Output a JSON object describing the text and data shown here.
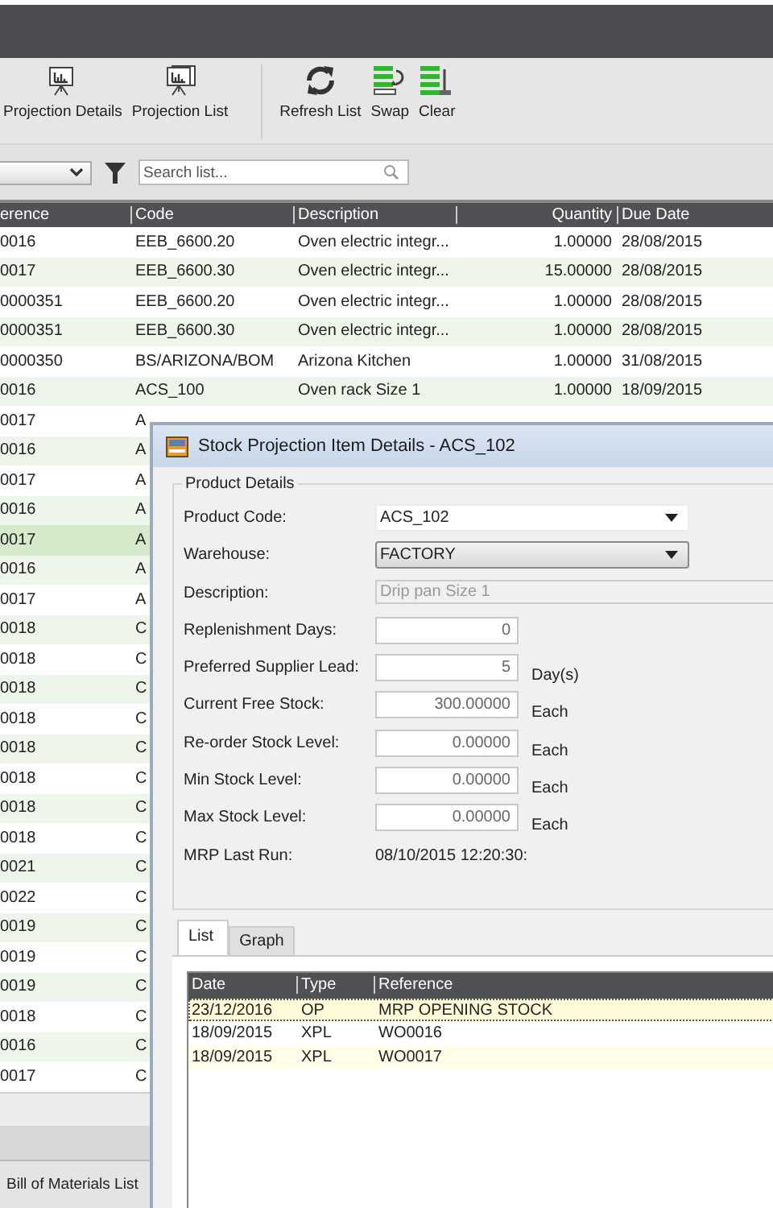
{
  "toolbar": {
    "groups": [
      [
        {
          "label": "Projection Details"
        },
        {
          "label": "Projection List"
        }
      ],
      [
        {
          "label": "Refresh List"
        },
        {
          "label": "Swap"
        },
        {
          "label": "Clear"
        }
      ]
    ]
  },
  "filter": {
    "search": {
      "placeholder": "Search list..."
    }
  },
  "table": {
    "columns": [
      "erence",
      "Code",
      "Description",
      "Quantity",
      "Due Date"
    ],
    "rows": [
      {
        "reference": "0016",
        "code": "EEB_6600.20",
        "description": "Oven electric integr...",
        "quantity": "1.00000",
        "due_date": "28/08/2015",
        "selected": false
      },
      {
        "reference": "0017",
        "code": "EEB_6600.30",
        "description": "Oven electric integr...",
        "quantity": "15.00000",
        "due_date": "28/08/2015",
        "selected": false
      },
      {
        "reference": "0000351",
        "code": "EEB_6600.20",
        "description": "Oven electric integr...",
        "quantity": "1.00000",
        "due_date": "28/08/2015",
        "selected": false
      },
      {
        "reference": "0000351",
        "code": "EEB_6600.30",
        "description": "Oven electric integr...",
        "quantity": "1.00000",
        "due_date": "28/08/2015",
        "selected": false
      },
      {
        "reference": "0000350",
        "code": "BS/ARIZONA/BOM",
        "description": "Arizona Kitchen",
        "quantity": "1.00000",
        "due_date": "31/08/2015",
        "selected": false
      },
      {
        "reference": "0016",
        "code": "ACS_100",
        "description": "Oven rack Size 1",
        "quantity": "1.00000",
        "due_date": "18/09/2015",
        "selected": false
      },
      {
        "reference": "0017",
        "code": "A",
        "selected": false
      },
      {
        "reference": "0016",
        "code": "A",
        "selected": false
      },
      {
        "reference": "0017",
        "code": "A",
        "selected": false
      },
      {
        "reference": "0016",
        "code": "A",
        "selected": false
      },
      {
        "reference": "0017",
        "code": "A",
        "selected": true
      },
      {
        "reference": "0016",
        "code": "A",
        "selected": false
      },
      {
        "reference": "0017",
        "code": "A",
        "selected": false
      },
      {
        "reference": "0018",
        "code": "C",
        "selected": false
      },
      {
        "reference": "0018",
        "code": "C",
        "selected": false
      },
      {
        "reference": "0018",
        "code": "C",
        "selected": false
      },
      {
        "reference": "0018",
        "code": "C",
        "selected": false
      },
      {
        "reference": "0018",
        "code": "C",
        "selected": false
      },
      {
        "reference": "0018",
        "code": "C",
        "selected": false
      },
      {
        "reference": "0018",
        "code": "C",
        "selected": false
      },
      {
        "reference": "0018",
        "code": "C",
        "selected": false
      },
      {
        "reference": "0021",
        "code": "C",
        "selected": false
      },
      {
        "reference": "0022",
        "code": "C",
        "selected": false
      },
      {
        "reference": "0019",
        "code": "C",
        "selected": false
      },
      {
        "reference": "0019",
        "code": "C",
        "selected": false
      },
      {
        "reference": "0019",
        "code": "C",
        "selected": false
      },
      {
        "reference": "0018",
        "code": "C",
        "selected": false
      },
      {
        "reference": "0016",
        "code": "C",
        "selected": false
      },
      {
        "reference": "0017",
        "code": "C",
        "selected": false
      }
    ]
  },
  "bottom_tab": {
    "label": "Bill of Materials List"
  },
  "dialog": {
    "title": "Stock Projection Item Details - ACS_102",
    "group_title": "Product Details",
    "fields": [
      {
        "kind": "dropdown",
        "label": "Product Code:",
        "value": "ACS_102"
      },
      {
        "kind": "select",
        "label": "Warehouse:",
        "value": "FACTORY"
      },
      {
        "kind": "disabled",
        "label": "Description:",
        "value": "Drip pan Size 1"
      },
      {
        "kind": "number",
        "label": "Replenishment Days:",
        "value": "0"
      },
      {
        "kind": "number",
        "label": "Preferred Supplier Lead:",
        "value": "5",
        "unit": "Day(s)"
      },
      {
        "kind": "number",
        "label": "Current Free Stock:",
        "value": "300.00000",
        "unit": "Each"
      },
      {
        "kind": "number",
        "label": "Re-order Stock Level:",
        "value": "0.00000",
        "unit": "Each"
      },
      {
        "kind": "number",
        "label": "Min Stock Level:",
        "value": "0.00000",
        "unit": "Each"
      },
      {
        "kind": "number",
        "label": "Max Stock Level:",
        "value": "0.00000",
        "unit": "Each"
      },
      {
        "kind": "text",
        "label": "MRP Last Run:",
        "value": "08/10/2015 12:20:30:"
      }
    ],
    "tabs": [
      {
        "label": "List",
        "selected": true
      },
      {
        "label": "Graph",
        "selected": false
      }
    ],
    "grid": {
      "columns": [
        "Date",
        "Type",
        "Reference"
      ],
      "rows": [
        {
          "date": "23/12/2016",
          "type": "OP",
          "reference": "MRP OPENING STOCK",
          "selected": true
        },
        {
          "date": "18/09/2015",
          "type": "XPL",
          "reference": "WO0016",
          "selected": false
        },
        {
          "date": "18/09/2015",
          "type": "XPL",
          "reference": "WO0017",
          "selected": false
        }
      ]
    }
  }
}
